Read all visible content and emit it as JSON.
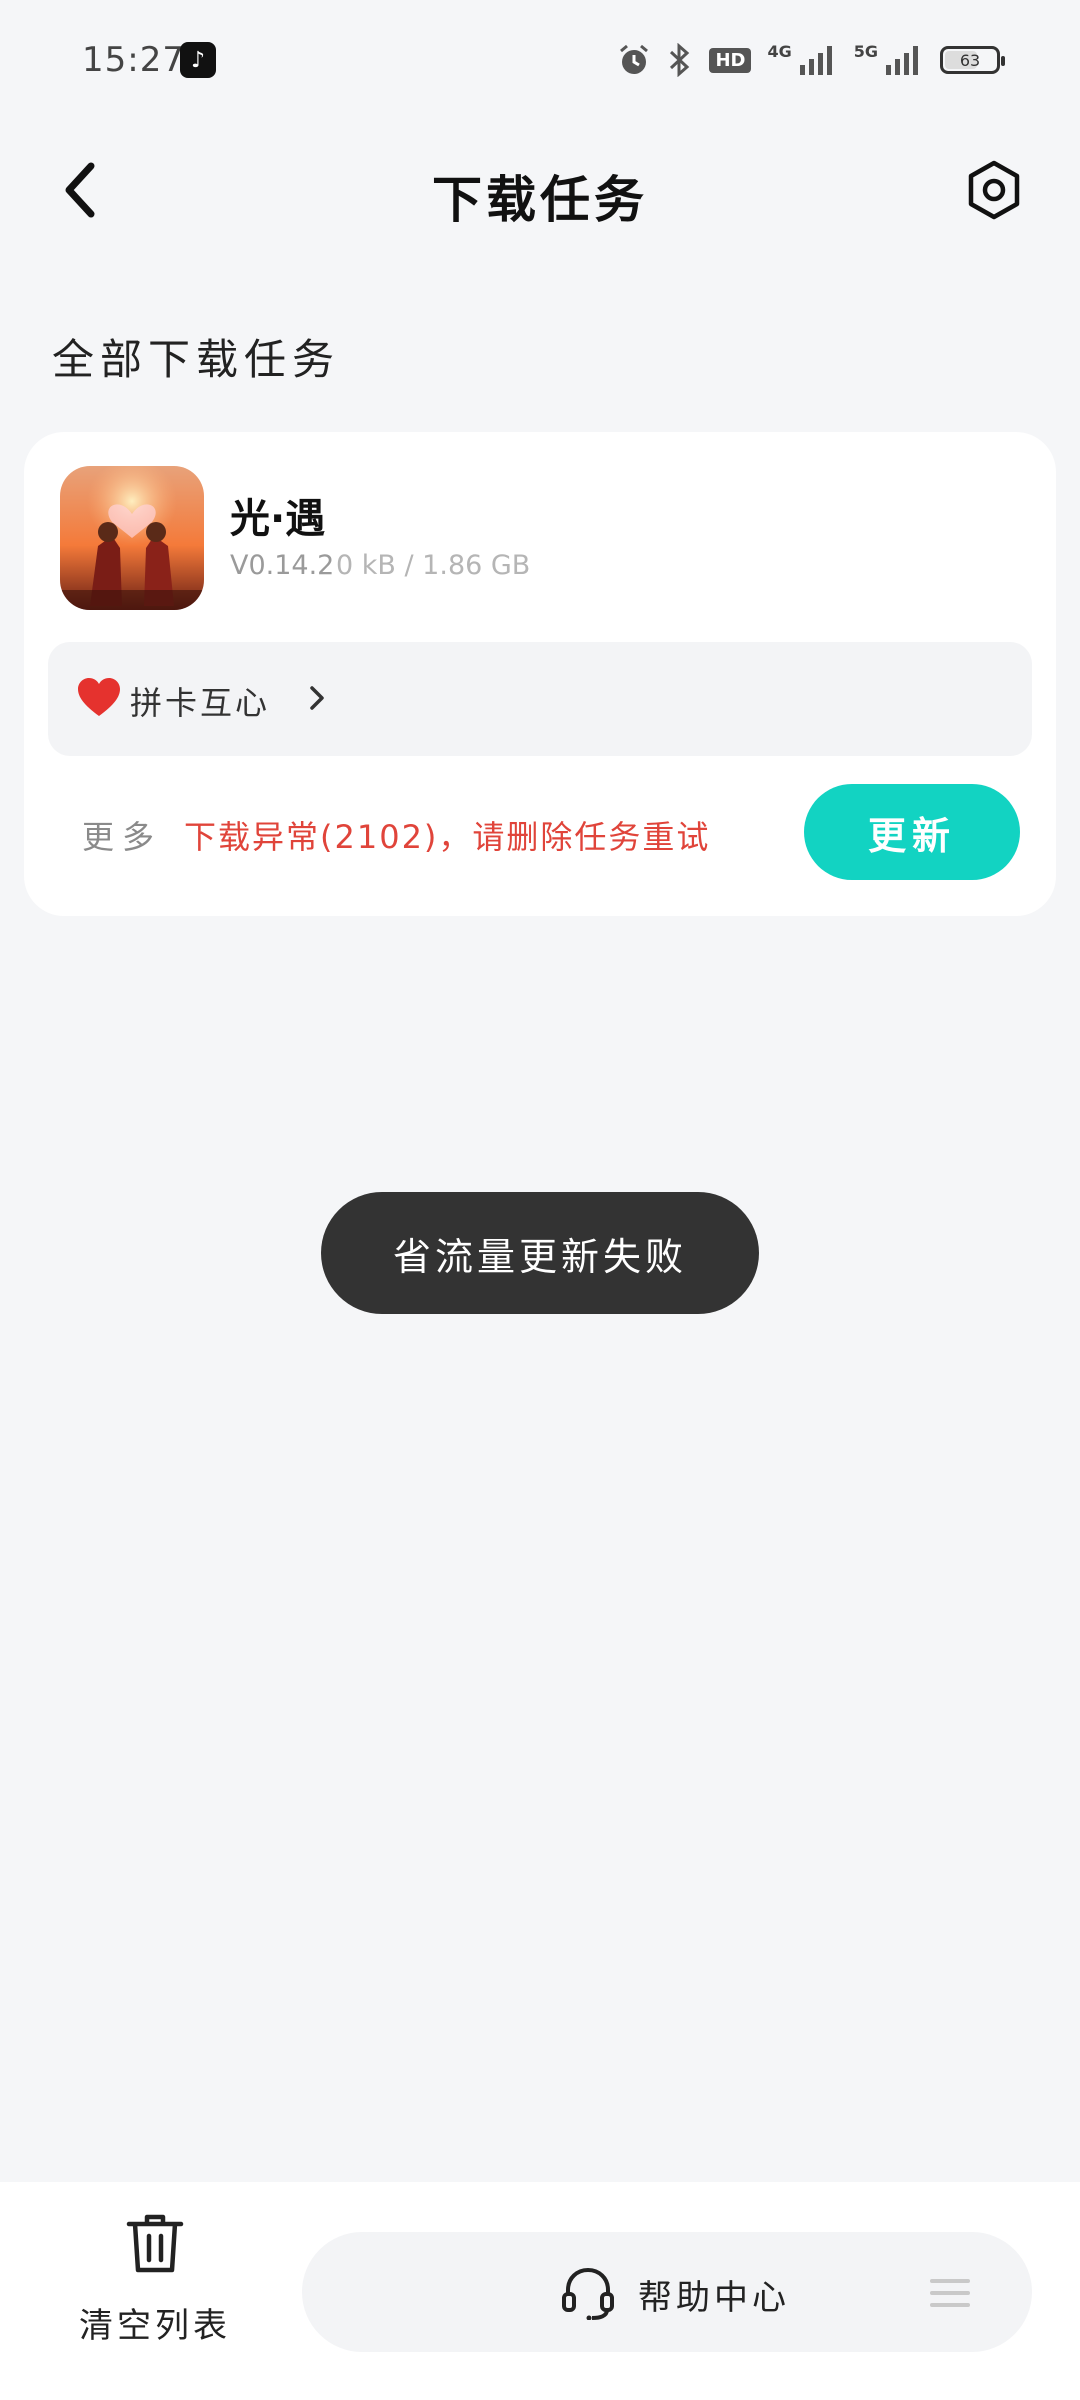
{
  "status_bar": {
    "time": "15:27",
    "tiktok_icon": "tiktok-icon",
    "hd_label": "HD",
    "network_4g": "4G",
    "network_5g": "5G",
    "battery": "63"
  },
  "header": {
    "title": "下载任务"
  },
  "section": {
    "title": "全部下载任务"
  },
  "task": {
    "app_name": "光·遇",
    "version": "V0.14.2",
    "size": "0 kB / 1.86 GB",
    "topic_label": "拼卡互心",
    "more_label": "更多",
    "error_text": "下载异常(2102)，请删除任务重试",
    "update_label": "更新"
  },
  "toast": {
    "text": "省流量更新失败"
  },
  "bottom": {
    "clear_label": "清空列表",
    "help_label": "帮助中心"
  },
  "colors": {
    "accent": "#12d3c2",
    "error": "#e0443a",
    "toast_bg": "#333333",
    "background": "#f5f6f8"
  }
}
